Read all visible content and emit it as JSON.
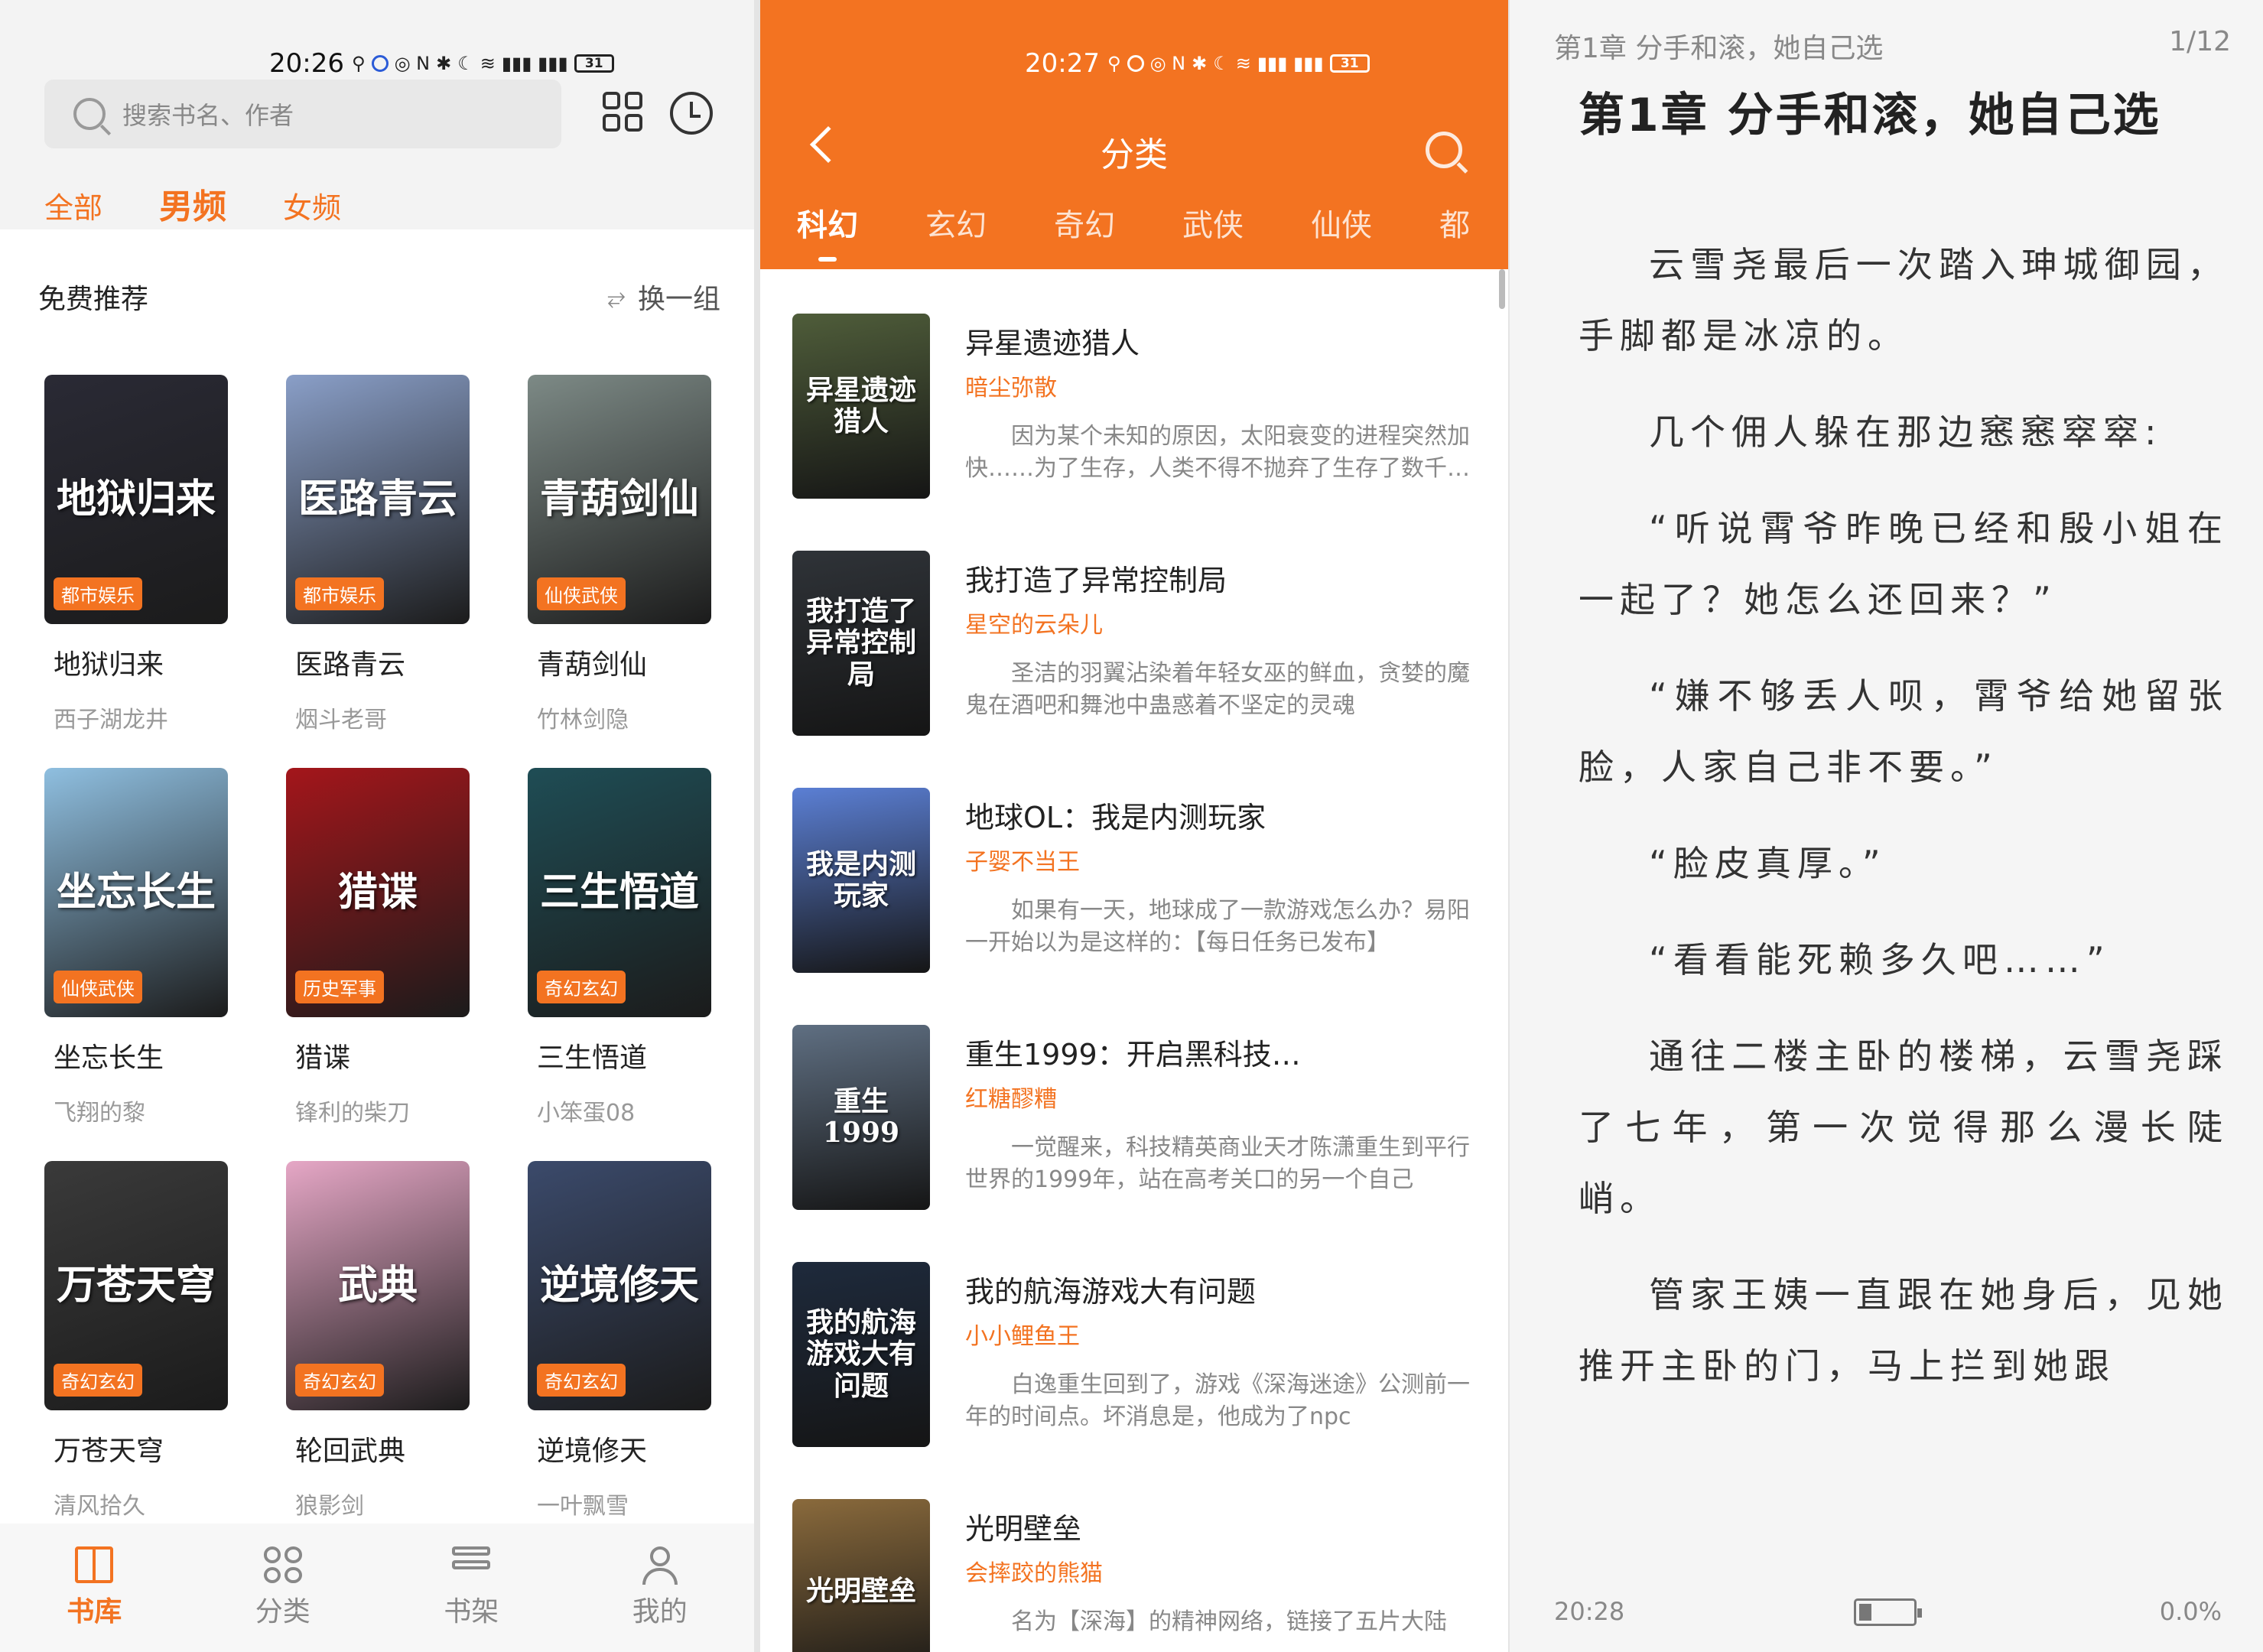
{
  "colors": {
    "accent": "#f37321",
    "muted": "#999999"
  },
  "p1": {
    "time": "20:26",
    "battery": "31",
    "search_placeholder": "搜索书名、作者",
    "filter_tabs": [
      "全部",
      "男频",
      "女频"
    ],
    "active_tab": 1,
    "section_title": "免费推荐",
    "refresh_label": "换一组",
    "books": [
      {
        "title": "地狱归来",
        "author": "西子湖龙井",
        "tag": "都市娱乐",
        "color": "#2a2a35",
        "cover_text": "地狱归来"
      },
      {
        "title": "医路青云",
        "author": "烟斗老哥",
        "tag": "都市娱乐",
        "color": "#8a9fc8",
        "cover_text": "医路青云"
      },
      {
        "title": "青葫剑仙",
        "author": "竹林剑隐",
        "tag": "仙侠武侠",
        "color": "#7d8a86",
        "cover_text": "青葫剑仙"
      },
      {
        "title": "坐忘长生",
        "author": "飞翔的黎",
        "tag": "仙侠武侠",
        "color": "#8fbfe0",
        "cover_text": "坐忘长生"
      },
      {
        "title": "猎谍",
        "author": "锋利的柴刀",
        "tag": "历史军事",
        "color": "#a4161b",
        "cover_text": "猎谍"
      },
      {
        "title": "三生悟道",
        "author": "小笨蛋08",
        "tag": "奇幻玄幻",
        "color": "#1f4d55",
        "cover_text": "三生悟道"
      },
      {
        "title": "万苍天穹",
        "author": "清风拾久",
        "tag": "奇幻玄幻",
        "color": "#3a3a3a",
        "cover_text": "万苍天穹"
      },
      {
        "title": "轮回武典",
        "author": "狼影剑",
        "tag": "奇幻玄幻",
        "color": "#e6a7c6",
        "cover_text": "武典"
      },
      {
        "title": "逆境修天",
        "author": "一叶飘雪",
        "tag": "奇幻玄幻",
        "color": "#3b4a6b",
        "cover_text": "逆境修天"
      }
    ],
    "nav": [
      "书库",
      "分类",
      "书架",
      "我的"
    ],
    "active_nav": 0
  },
  "p2": {
    "time": "20:27",
    "battery": "31",
    "title": "分类",
    "tabs": [
      "科幻",
      "玄幻",
      "奇幻",
      "武侠",
      "仙侠",
      "都"
    ],
    "active_tab": 0,
    "books": [
      {
        "title": "异星遗迹猎人",
        "author": "暗尘弥散",
        "desc": "因为某个未知的原因，太阳衰变的进程突然加快……为了生存，人类不得不抛弃了生存了数千年的家园",
        "color": "#4f5d3a",
        "cover_text": "异星遗迹猎人"
      },
      {
        "title": "我打造了异常控制局",
        "author": "星空的云朵儿",
        "desc": "圣洁的羽翼沾染着年轻女巫的鲜血，贪婪的魔鬼在酒吧和舞池中蛊惑着不坚定的灵魂",
        "color": "#2f3338",
        "cover_text": "我打造了异常控制局"
      },
      {
        "title": "地球OL：我是内测玩家",
        "author": "子婴不当王",
        "desc": "如果有一天，地球成了一款游戏怎么办？易阳一开始以为是这样的：【每日任务已发布】",
        "color": "#5b7fd4",
        "cover_text": "我是内测玩家"
      },
      {
        "title": "重生1999：开启黑科技…",
        "author": "红糖醪糟",
        "desc": "一觉醒来，科技精英商业天才陈潇重生到平行世界的1999年，站在高考关口的另一个自己",
        "color": "#5f6f82",
        "cover_text": "重生1999"
      },
      {
        "title": "我的航海游戏大有问题",
        "author": "小小鲤鱼王",
        "desc": "白逸重生回到了，游戏《深海迷途》公测前一年的时间点。坏消息是，他成为了npc",
        "color": "#1e2a3c",
        "cover_text": "我的航海游戏大有问题"
      },
      {
        "title": "光明壁垒",
        "author": "会摔跤的熊猫",
        "desc": "名为【深海】的精神网络，链接了五片大陆",
        "color": "#8a6a3c",
        "cover_text": "光明壁垒"
      }
    ]
  },
  "p3": {
    "chapter_header": "第1章 分手和滚，她自己选",
    "page": "1/12",
    "title": "第1章 分手和滚，她自己选",
    "paragraphs": [
      "云雪尧最后一次踏入珅城御园，手脚都是冰凉的。",
      "几个佣人躲在那边窸窸窣窣:",
      "“听说霄爷昨晚已经和殷小姐在一起了？她怎么还回来？”",
      "“嫌不够丢人呗，霄爷给她留张脸，人家自己非不要。”",
      "“脸皮真厚。”",
      "“看看能死赖多久吧……”",
      "通往二楼主卧的楼梯，云雪尧踩了七年，第一次觉得那么漫长陡峭。",
      "管家王姨一直跟在她身后，见她推开主卧的门，马上拦到她跟"
    ],
    "time": "20:28",
    "progress": "0.0%"
  }
}
